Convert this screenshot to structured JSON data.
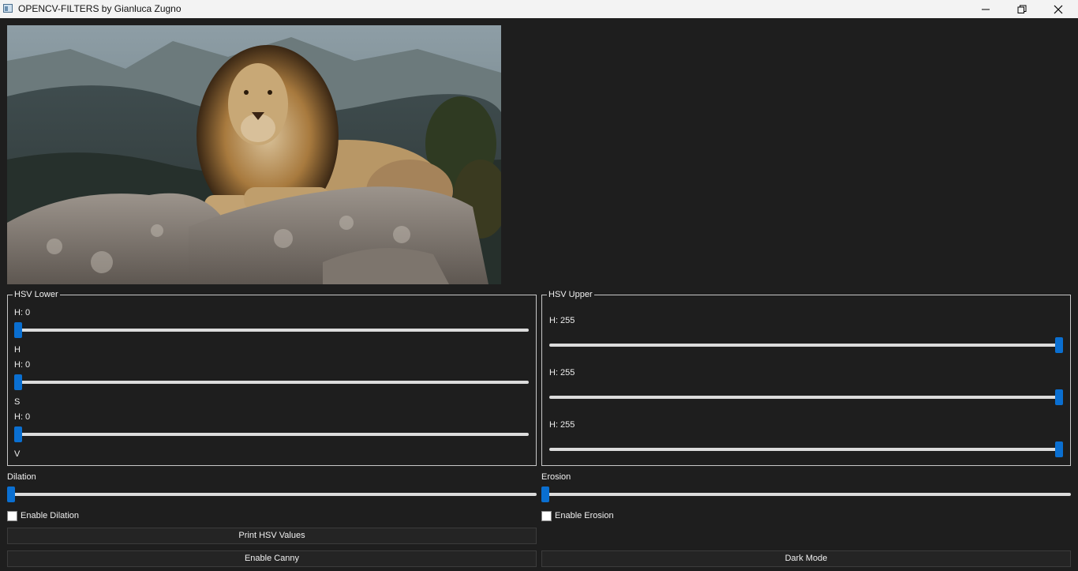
{
  "window": {
    "title": "OPENCV-FILTERS by Gianluca Zugno",
    "icons": {
      "app": "app-window-icon",
      "minimize": "minimize-icon",
      "maximize": "restore-icon",
      "close": "close-icon"
    }
  },
  "preview": {
    "image_name": "lion-photo"
  },
  "hsv_lower": {
    "title": "HSV Lower",
    "sliders": [
      {
        "value_label": "H: 0",
        "channel_label": "H",
        "value": 0
      },
      {
        "value_label": "H: 0",
        "channel_label": "S",
        "value": 0
      },
      {
        "value_label": "H: 0",
        "channel_label": "V",
        "value": 0
      }
    ],
    "max": 255
  },
  "hsv_upper": {
    "title": "HSV Upper",
    "sliders": [
      {
        "value_label": "H: 255",
        "value": 255
      },
      {
        "value_label": "H: 255",
        "value": 255
      },
      {
        "value_label": "H: 255",
        "value": 255
      }
    ],
    "max": 255
  },
  "dilation": {
    "label": "Dilation",
    "value": 0,
    "checkbox_label": "Enable Dilation",
    "checked": false
  },
  "erosion": {
    "label": "Erosion",
    "value": 0,
    "checkbox_label": "Enable Erosion",
    "checked": false
  },
  "buttons": {
    "print_hsv": "Print HSV Values",
    "enable_canny": "Enable Canny",
    "dark_mode": "Dark Mode"
  },
  "colors": {
    "accent": "#0a6fd1",
    "background": "#1e1e1e",
    "titlebar": "#f3f3f3"
  }
}
